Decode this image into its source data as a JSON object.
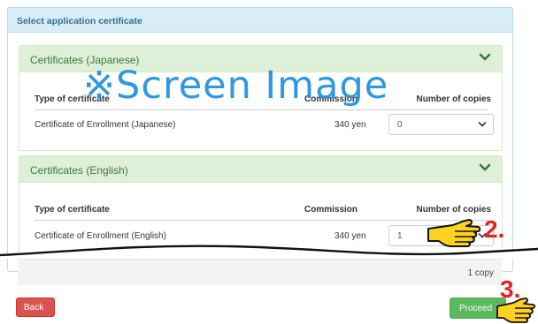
{
  "panel": {
    "title": "Select application certificate"
  },
  "sections": [
    {
      "title": "Certificates (Japanese)",
      "columns": {
        "type": "Type of certificate",
        "commission": "Commission",
        "copies": "Number of copies"
      },
      "row": {
        "name": "Certificate of Enrollment (Japanese)",
        "fee": "340 yen",
        "copies_value": "0"
      }
    },
    {
      "title": "Certificates (English)",
      "columns": {
        "type": "Type of certificate",
        "commission": "Commission",
        "copies": "Number of copies"
      },
      "row": {
        "name": "Certificate of Enrollment (English)",
        "fee": "340 yen",
        "copies_value": "1"
      }
    }
  ],
  "summary": {
    "total": "1 copy"
  },
  "buttons": {
    "back": "Back",
    "proceed": "Proceed"
  },
  "overlay": {
    "watermark": "※Screen Image",
    "step2": "2.",
    "step3": "3."
  },
  "colors": {
    "info_header": "#d9edf7",
    "success_header": "#dff0d8",
    "back": "#d9534f",
    "proceed": "#5cb85c",
    "step_red": "#e8201e",
    "watermark": "#1e8fe0"
  },
  "icons": {
    "collapse": "chevron-down-icon",
    "pointer": "pointing-hand-icon"
  }
}
